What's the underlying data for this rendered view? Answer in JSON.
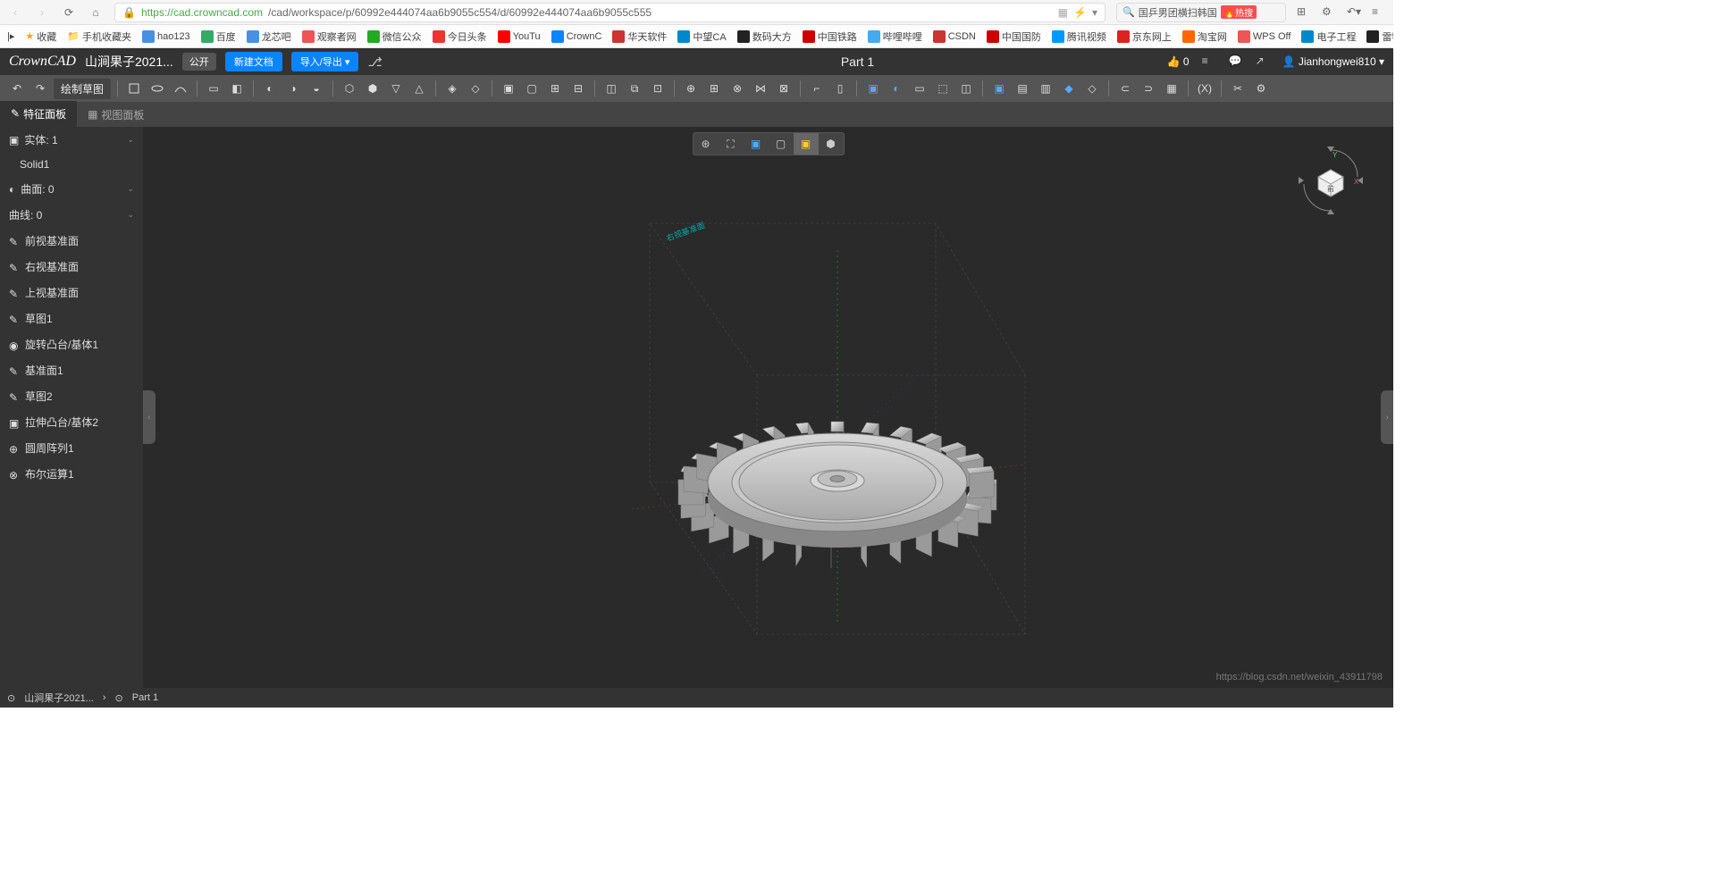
{
  "browser": {
    "url_host": "https://cad.crowncad.com",
    "url_path": "/cad/workspace/p/60992e444074aa6b9055c554/d/60992e444074aa6b9055c555",
    "search_text": "国乒男团横扫韩国",
    "hot_label": "🔥热搜"
  },
  "bookmarks": [
    {
      "label": "收藏"
    },
    {
      "label": "手机收藏夹"
    },
    {
      "label": "hao123"
    },
    {
      "label": "百度"
    },
    {
      "label": "龙芯吧"
    },
    {
      "label": "观察者网"
    },
    {
      "label": "微信公众"
    },
    {
      "label": "今日头条"
    },
    {
      "label": "YouTu"
    },
    {
      "label": "CrownC"
    },
    {
      "label": "华天软件"
    },
    {
      "label": "中望CA"
    },
    {
      "label": "数码大方"
    },
    {
      "label": "中国铁路"
    },
    {
      "label": "哔哩哔哩"
    },
    {
      "label": "CSDN"
    },
    {
      "label": "中国国防"
    },
    {
      "label": "腾讯视频"
    },
    {
      "label": "京东网上"
    },
    {
      "label": "淘宝网"
    },
    {
      "label": "WPS Off"
    },
    {
      "label": "电子工程"
    },
    {
      "label": "雷特视频"
    }
  ],
  "app": {
    "logo": "CrownCAD",
    "doc_title": "山涧果子2021...",
    "public_label": "公开",
    "new_doc": "新建文档",
    "import_export": "导入/导出 ▾",
    "part_name": "Part 1",
    "likes": "0",
    "user": "Jianhongwei810"
  },
  "toolbar": {
    "draw_sketch": "绘制草图"
  },
  "panels": {
    "feature": "特征面板",
    "view": "视图面板"
  },
  "sidebar": {
    "groups": [
      {
        "label": "实体: 1",
        "items": [
          "Solid1"
        ]
      },
      {
        "label": "曲面: 0",
        "items": []
      },
      {
        "label": "曲线: 0",
        "items": []
      }
    ],
    "features": [
      {
        "icon": "✎",
        "label": "前视基准面"
      },
      {
        "icon": "✎",
        "label": "右视基准面"
      },
      {
        "icon": "✎",
        "label": "上视基准面"
      },
      {
        "icon": "✎",
        "label": "草图1"
      },
      {
        "icon": "◉",
        "label": "旋转凸台/基体1"
      },
      {
        "icon": "✎",
        "label": "基准面1"
      },
      {
        "icon": "✎",
        "label": "草图2"
      },
      {
        "icon": "▣",
        "label": "拉伸凸台/基体2"
      },
      {
        "icon": "⊕",
        "label": "圆周阵列1"
      },
      {
        "icon": "⊗",
        "label": "布尔运算1"
      }
    ]
  },
  "status": {
    "breadcrumb1": "山涧果子2021...",
    "breadcrumb2": "Part 1"
  },
  "watermark": "https://blog.csdn.net/weixin_43911798"
}
